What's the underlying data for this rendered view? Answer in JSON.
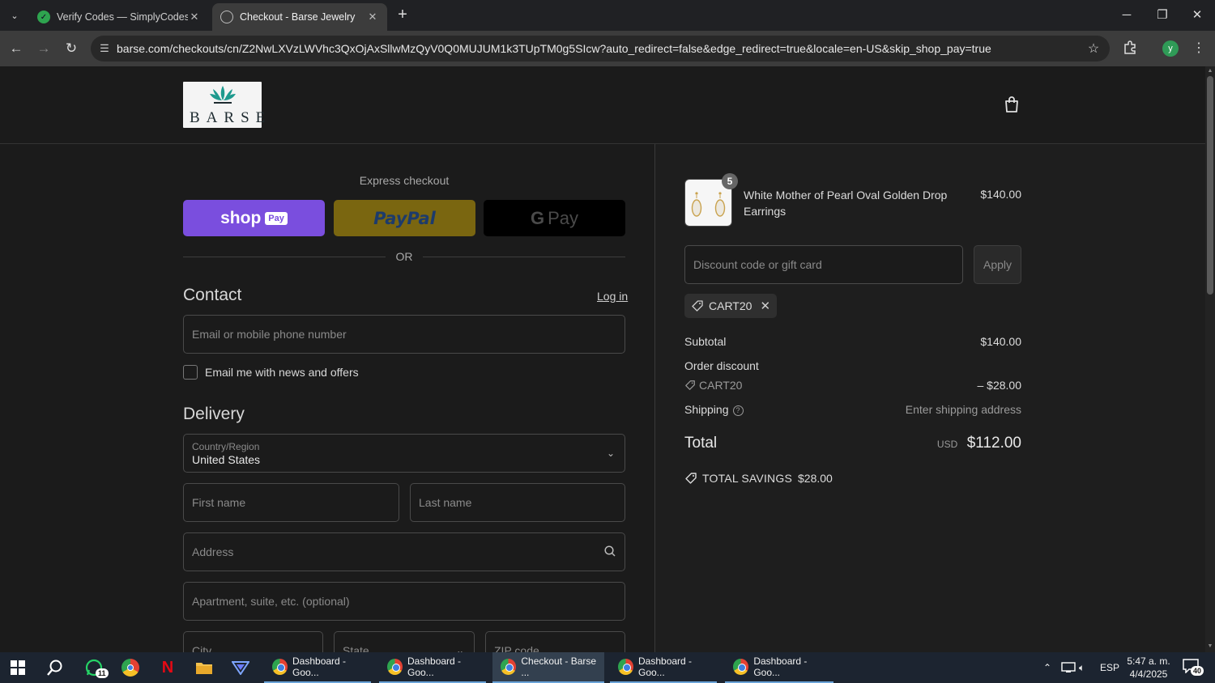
{
  "browser": {
    "tabs": [
      {
        "title": "Verify Codes — SimplyCodes",
        "active": false
      },
      {
        "title": "Checkout - Barse Jewelry",
        "active": true
      }
    ],
    "url": "barse.com/checkouts/cn/Z2NwLXVzLWVhc3QxOjAxSllwMzQyV0Q0MUJUM1k3TUpTM0g5SIcw?auto_redirect=false&edge_redirect=true&locale=en-US&skip_shop_pay=true",
    "profile_initial": "y"
  },
  "header": {
    "logo_text": "BARSE"
  },
  "express": {
    "title": "Express checkout",
    "shop_label": "shop",
    "shop_pay_badge": "Pay",
    "paypal_label": "PayPal",
    "gpay_g": "G",
    "gpay_label": "Pay",
    "or_text": "OR"
  },
  "contact": {
    "heading": "Contact",
    "login_link": "Log in",
    "email_placeholder": "Email or mobile phone number",
    "news_label": "Email me with news and offers"
  },
  "delivery": {
    "heading": "Delivery",
    "country_label": "Country/Region",
    "country_value": "United States",
    "first_name_placeholder": "First name",
    "last_name_placeholder": "Last name",
    "address_placeholder": "Address",
    "apartment_placeholder": "Apartment, suite, etc. (optional)",
    "city_placeholder": "City",
    "state_placeholder": "State",
    "zip_placeholder": "ZIP code"
  },
  "summary": {
    "product": {
      "quantity": "5",
      "name": "White Mother of Pearl Oval Golden Drop Earrings",
      "price": "$140.00"
    },
    "discount_placeholder": "Discount code or gift card",
    "apply_label": "Apply",
    "applied_code": "CART20",
    "subtotal_label": "Subtotal",
    "subtotal_value": "$140.00",
    "order_discount_label": "Order discount",
    "discount_code": "CART20",
    "discount_value": "– $28.00",
    "shipping_label": "Shipping",
    "shipping_value": "Enter shipping address",
    "total_label": "Total",
    "currency": "USD",
    "total_value": "$112.00",
    "savings_label": "TOTAL SAVINGS",
    "savings_value": "$28.00"
  },
  "taskbar": {
    "apps": [
      {
        "label": "Dashboard - Goo...",
        "active": false
      },
      {
        "label": "Dashboard - Goo...",
        "active": false
      },
      {
        "label": "Checkout - Barse ...",
        "active": true
      },
      {
        "label": "Dashboard - Goo...",
        "active": false
      },
      {
        "label": "Dashboard - Goo...",
        "active": false
      }
    ],
    "whatsapp_badge": "11",
    "language": "ESP",
    "time": "5:47 a. m.",
    "date": "4/4/2025",
    "notifications": "40"
  },
  "colors": {
    "shop_pay": "#7a4ede",
    "paypal": "#7a6610",
    "page_bg": "#1b1b1b"
  }
}
